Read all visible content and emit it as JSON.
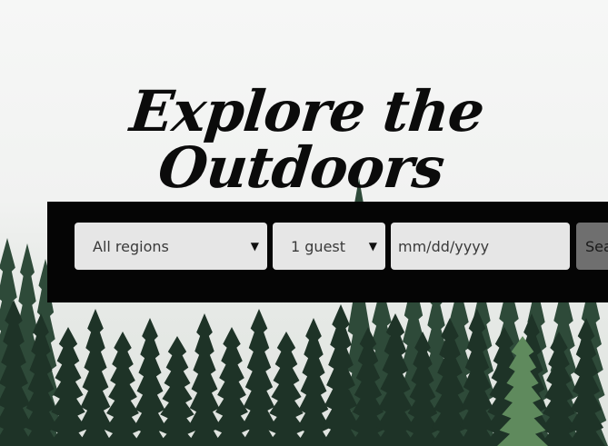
{
  "hero": {
    "headline": "Explore the Outdoors"
  },
  "search": {
    "region": {
      "value": "All regions",
      "arrow": "▼"
    },
    "guests": {
      "value": "1 guest",
      "arrow": "▼"
    },
    "date": {
      "placeholder": "mm/dd/yyyy"
    },
    "button_label": "Sea"
  },
  "colors": {
    "search_bar_bg": "#050505",
    "field_bg": "#e6e6e6",
    "button_bg": "#6f6f6f",
    "tree_dark": "#1e3327",
    "tree_mid": "#2e4a39",
    "tree_light": "#5f8a5d"
  }
}
